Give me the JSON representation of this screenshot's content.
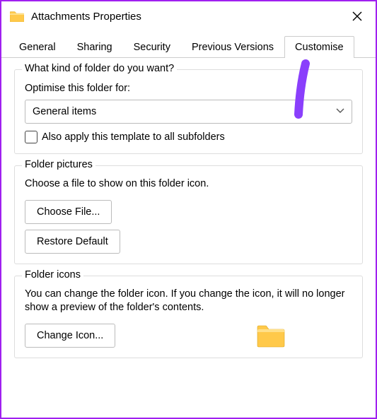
{
  "titlebar": {
    "title": "Attachments Properties"
  },
  "tabs": {
    "items": [
      {
        "label": "General"
      },
      {
        "label": "Sharing"
      },
      {
        "label": "Security"
      },
      {
        "label": "Previous Versions"
      },
      {
        "label": "Customise"
      }
    ],
    "active_index": 4
  },
  "group_kind": {
    "title": "What kind of folder do you want?",
    "optimize_label": "Optimise this folder for:",
    "dropdown_value": "General items",
    "checkbox_label": "Also apply this template to all subfolders"
  },
  "group_pictures": {
    "title": "Folder pictures",
    "desc": "Choose a file to show on this folder icon.",
    "choose_label": "Choose File...",
    "restore_label": "Restore Default"
  },
  "group_icons": {
    "title": "Folder icons",
    "desc": "You can change the folder icon. If you change the icon, it will no longer show a preview of the folder's contents.",
    "change_label": "Change Icon..."
  }
}
